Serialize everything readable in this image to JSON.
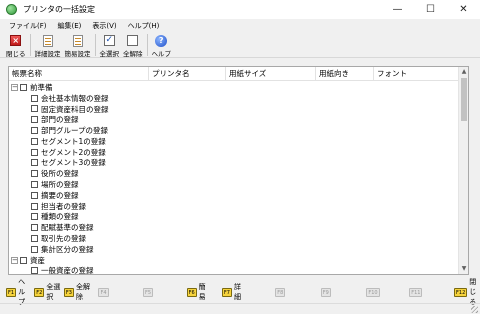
{
  "window": {
    "title": "プリンタの一括設定",
    "controls": [
      "—",
      "☐",
      "✕"
    ]
  },
  "menu": [
    "ファイル(F)",
    "編集(E)",
    "表示(V)",
    "ヘルプ(H)"
  ],
  "toolbar": {
    "close_label": "閉じる",
    "detail_label": "詳細設定",
    "simple_label": "簡易設定",
    "select_all_label": "全選択",
    "deselect_all_label": "全解除",
    "help_label": "ヘルプ"
  },
  "columns": [
    "帳票名称",
    "プリンタ名",
    "用紙サイズ",
    "用紙向き",
    "フォント"
  ],
  "groups": [
    {
      "name": "前準備",
      "expanded": true,
      "items": [
        "会社基本情報の登録",
        "固定資産科目の登録",
        "部門の登録",
        "部門グループの登録",
        "セグメント1の登録",
        "セグメント2の登録",
        "セグメント3の登録",
        "役所の登録",
        "場所の登録",
        "摘要の登録",
        "担当者の登録",
        "種類の登録",
        "配賦基準の登録",
        "取引先の登録",
        "集計区分の登録"
      ]
    },
    {
      "name": "資産",
      "expanded": true,
      "items": [
        "一般資産の登録"
      ]
    }
  ],
  "fkeys": [
    {
      "key": "F1",
      "label": "ヘルプ",
      "enabled": true
    },
    {
      "key": "F2",
      "label": "全選択",
      "enabled": true
    },
    {
      "key": "F3",
      "label": "全解除",
      "enabled": true
    },
    {
      "key": "F4",
      "label": "",
      "enabled": false
    },
    {
      "key": "F5",
      "label": "",
      "enabled": false
    },
    {
      "key": "F6",
      "label": "簡易",
      "enabled": true
    },
    {
      "key": "F7",
      "label": "詳細",
      "enabled": true
    },
    {
      "key": "F8",
      "label": "",
      "enabled": false
    },
    {
      "key": "F9",
      "label": "",
      "enabled": false
    },
    {
      "key": "F10",
      "label": "",
      "enabled": false
    },
    {
      "key": "F11",
      "label": "",
      "enabled": false
    },
    {
      "key": "F12",
      "label": "閉じる",
      "enabled": true
    }
  ]
}
